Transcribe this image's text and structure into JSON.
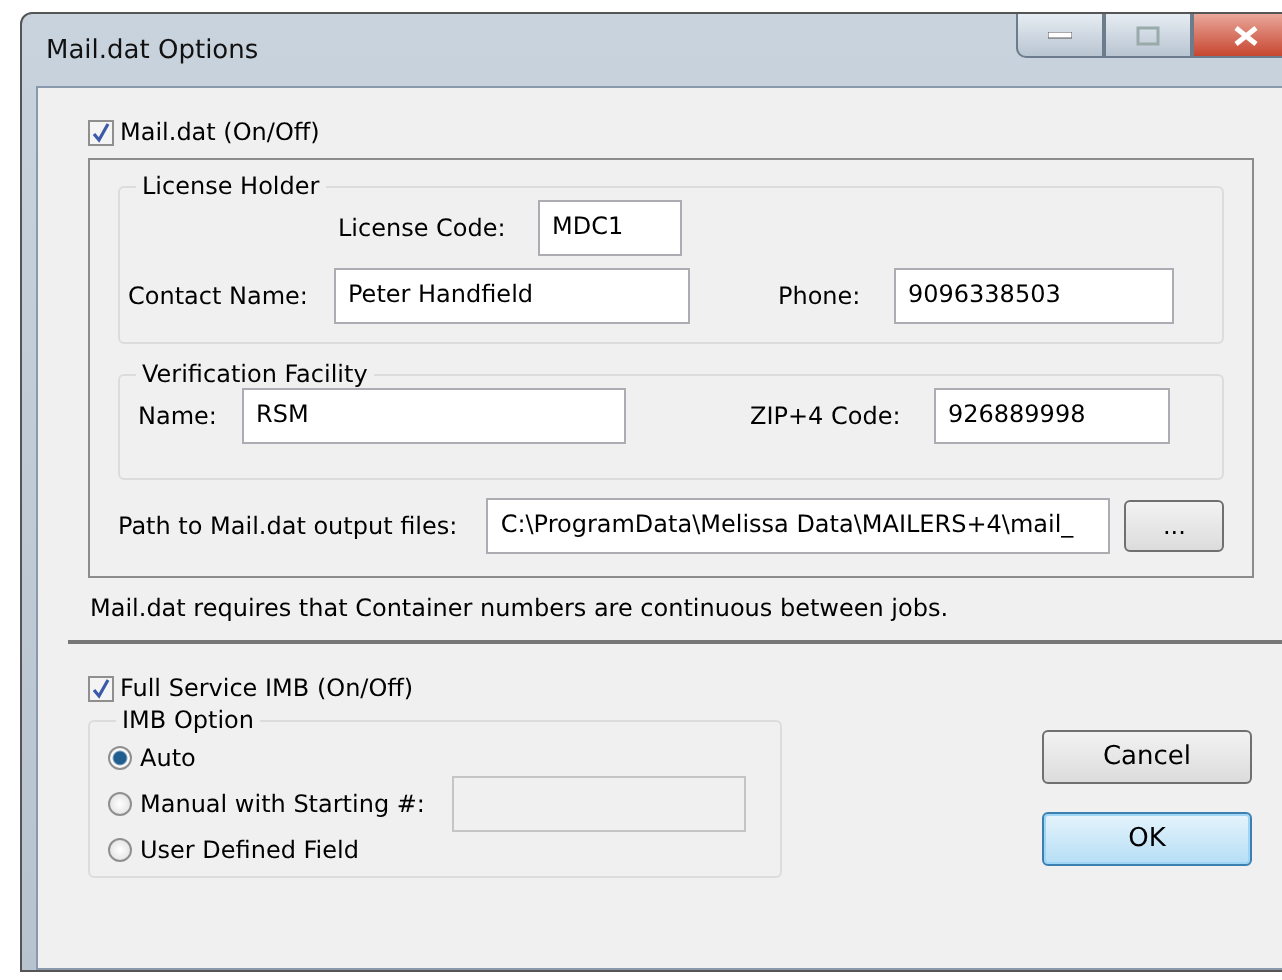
{
  "window": {
    "title": "Mail.dat Options"
  },
  "maildat": {
    "label": "Mail.dat (On/Off)",
    "checked": true
  },
  "license_holder": {
    "title": "License Holder",
    "license_code": {
      "label": "License Code:",
      "value": "MDC1"
    },
    "contact_name": {
      "label": "Contact Name:",
      "value": "Peter Handfield"
    },
    "phone": {
      "label": "Phone:",
      "value": "9096338503"
    }
  },
  "verification_facility": {
    "title": "Verification Facility",
    "name": {
      "label": "Name:",
      "value": "RSM"
    },
    "zip": {
      "label": "ZIP+4 Code:",
      "value": "926889998"
    }
  },
  "path": {
    "label": "Path to Mail.dat output files:",
    "value": "C:\\ProgramData\\Melissa Data\\MAILERS+4\\mail_",
    "browse": "..."
  },
  "note": "Mail.dat requires that Container numbers are continuous between jobs.",
  "full_service": {
    "label": "Full Service IMB (On/Off)",
    "checked": true
  },
  "imb_option": {
    "title": "IMB Option",
    "options": [
      {
        "label": "Auto",
        "selected": true
      },
      {
        "label": "Manual with Starting #:",
        "selected": false,
        "field_disabled": true
      },
      {
        "label": "User Defined Field",
        "selected": false
      }
    ]
  },
  "buttons": [
    {
      "label": "Cancel",
      "default": false
    },
    {
      "label": "OK",
      "default": true
    }
  ]
}
